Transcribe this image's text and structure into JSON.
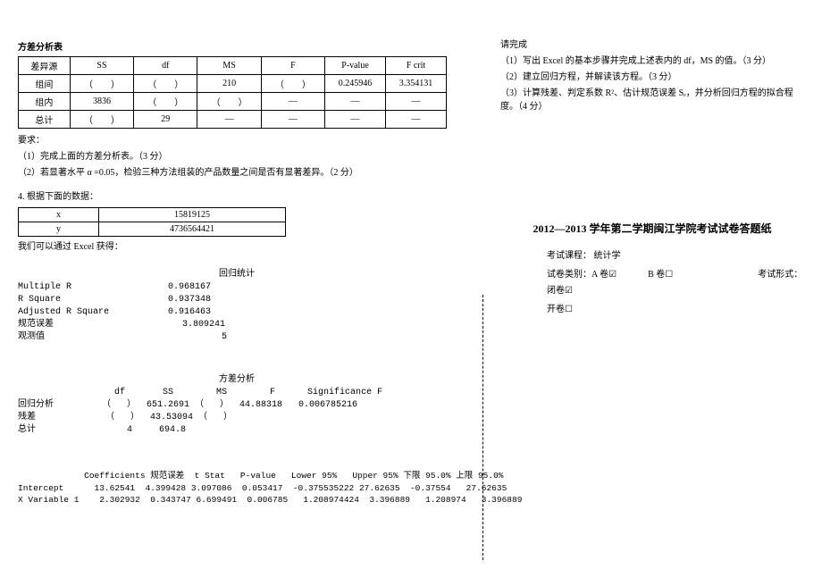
{
  "left": {
    "anova_title": "方差分析表",
    "anova_headers": [
      "差异源",
      "SS",
      "df",
      "MS",
      "F",
      "P-value",
      "F crit"
    ],
    "anova_rows": [
      [
        "组间",
        "（　　）",
        "（　　）",
        "210",
        "（　　）",
        "0.245946",
        "3.354131"
      ],
      [
        "组内",
        "3836",
        "（　　）",
        "（　　）",
        "—",
        "—",
        "—"
      ],
      [
        "总计",
        "（　　）",
        "29",
        "—",
        "—",
        "—",
        "—"
      ]
    ],
    "req_label": "要求：",
    "req1": "（1）完成上面的方差分析表。（3 分）",
    "req2": "（2）若显著水平 α =0.05，检验三种方法组装的产品数量之间是否有显著差异。（2 分）",
    "q4_label": "4. 根据下面的数据：",
    "xy_rows": [
      [
        "x",
        "15819125"
      ],
      [
        "y",
        "4736564421"
      ]
    ],
    "excel_note": "我们可以通过 Excel 获得：",
    "reg_header": "回归统计",
    "reg_stats": [
      [
        "Multiple R",
        "0.968167"
      ],
      [
        "R Square",
        "0.937348"
      ],
      [
        "Adjusted R Square",
        "0.916463"
      ],
      [
        "规范误差",
        "3.809241"
      ],
      [
        "观测值",
        "5"
      ]
    ],
    "anova2_header": "方差分析",
    "anova2_cols": "                  df       SS        MS        F      Significance F",
    "anova2_rows": [
      "回归分析         （   ）  651.2691 （   ）  44.88318   0.006785216",
      "残差             （   ）  43.53094 （   ）",
      "总计                 4     694.8"
    ],
    "coef_header": "             Coefficients 规范误差  t Stat   P-value   Lower 95%   Upper 95% 下限 95.0% 上限 95.0%",
    "coef_rows": [
      "Intercept      13.62541  4.399428 3.097086  0.053417  -0.375535222 27.62635  -0.37554   27.62635",
      "X Variable 1    2.302932  0.343747 6.699491  0.006785   1.208974424  3.396889   1.208974   3.396889"
    ]
  },
  "right": {
    "task_label": "请完成",
    "t1": "（1）写出 Excel 的基本步骤并完成上述表内的 df，MS 的值。（3 分）",
    "t2": "（2）建立回归方程，并解读该方程。（3 分）",
    "t3": "（3）计算残差、判定系数 R²、估计规范误差 Sₑ，并分析回归方程的拟合程度。（4 分）",
    "title": "2012—2013 学年第二学期闽江学院考试试卷答题纸",
    "course_line": "考试课程：  统计学",
    "type_line_a": "试卷类别：A 卷☑",
    "type_line_b": "B 卷☐",
    "form_line": "考试形式：闭卷☑",
    "open_line": "开卷☐"
  }
}
